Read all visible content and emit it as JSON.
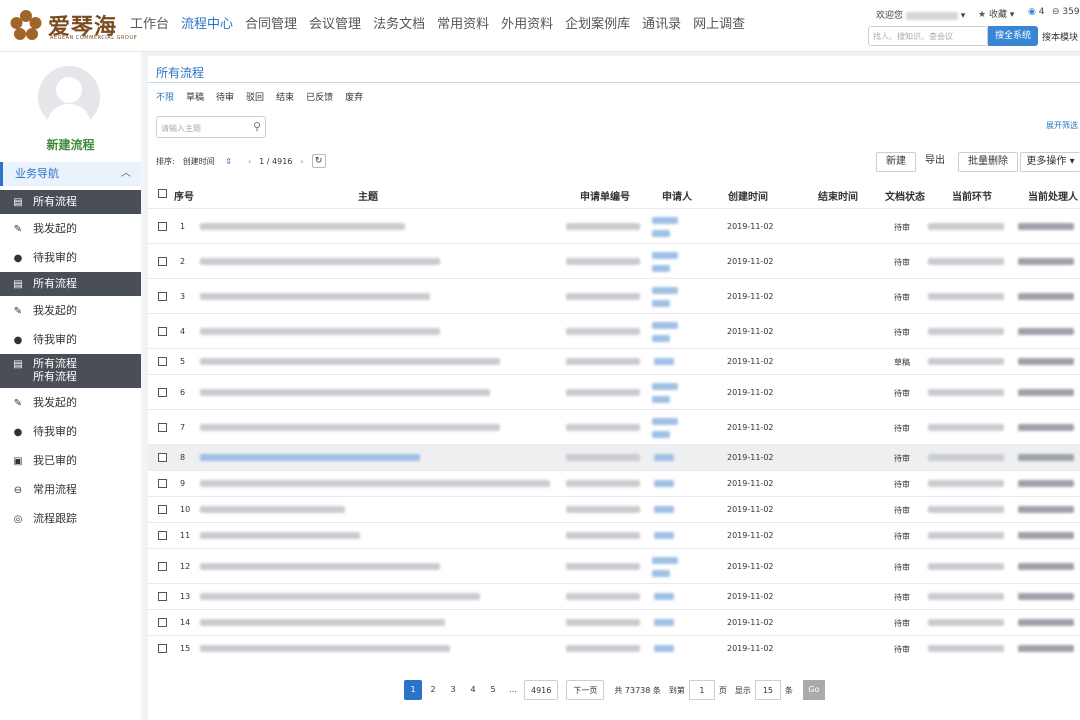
{
  "header": {
    "logo_text": "爱琴海",
    "logo_sub": "AEGEAN COMMERCIAL GROUP",
    "nav": [
      {
        "label": "工作台",
        "active": false
      },
      {
        "label": "流程中心",
        "active": true
      },
      {
        "label": "合同管理",
        "active": false
      },
      {
        "label": "会议管理",
        "active": false
      },
      {
        "label": "法务文档",
        "active": false
      },
      {
        "label": "常用资料",
        "active": false
      },
      {
        "label": "外用资料",
        "active": false
      },
      {
        "label": "企划案例库",
        "active": false
      },
      {
        "label": "通讯录",
        "active": false
      },
      {
        "label": "网上调查",
        "active": false
      }
    ],
    "welcome": "欢迎您",
    "favorites": "收藏",
    "badge_count_a": "4",
    "badge_count_b": "359",
    "search_placeholder": "找人、搜知识、查会议",
    "search_button": "搜全系统",
    "search_module": "搜本模块"
  },
  "sidebar": {
    "new_flow": "新建流程",
    "biz_nav": "业务导航",
    "items": [
      {
        "label": "所有流程",
        "icon": "doc-icon",
        "style": "dark"
      },
      {
        "label": "我发起的",
        "icon": "edit-icon",
        "style": ""
      },
      {
        "label": "待我审的",
        "icon": "user-icon",
        "style": ""
      },
      {
        "label": "所有流程",
        "icon": "doc-icon",
        "style": "dark"
      },
      {
        "label": "我发起的",
        "icon": "edit-icon",
        "style": ""
      },
      {
        "label": "待我审的",
        "icon": "user-icon",
        "style": ""
      },
      {
        "label": "所有流程",
        "label2": "所有流程",
        "icon": "doc-icon",
        "style": "dark2"
      },
      {
        "label": "我发起的",
        "icon": "edit-icon",
        "style": ""
      },
      {
        "label": "待我审的",
        "icon": "user-icon",
        "style": ""
      },
      {
        "label": "我已审的",
        "icon": "archive-icon",
        "style": ""
      },
      {
        "label": "常用流程",
        "icon": "minus-circle-icon",
        "style": ""
      },
      {
        "label": "流程跟踪",
        "icon": "target-icon",
        "style": ""
      }
    ]
  },
  "main": {
    "title": "所有流程",
    "tabs": [
      {
        "label": "不限",
        "active": true
      },
      {
        "label": "草稿",
        "active": false
      },
      {
        "label": "待审",
        "active": false
      },
      {
        "label": "驳回",
        "active": false
      },
      {
        "label": "结束",
        "active": false
      },
      {
        "label": "已反馈",
        "active": false
      },
      {
        "label": "废弃",
        "active": false
      }
    ],
    "search_placeholder": "请输入主题",
    "expand_filter": "展开筛选",
    "sort_label": "排序:",
    "sort_value": "创建时间",
    "page_indicator": "1 / 4916",
    "buttons": {
      "new": "新建",
      "export": "导出",
      "batch_delete": "批量删除",
      "more": "更多操作"
    },
    "columns": [
      "序号",
      "主题",
      "申请单编号",
      "申请人",
      "创建时间",
      "结束时间",
      "文档状态",
      "当前环节",
      "当前处理人"
    ],
    "rows": [
      {
        "no": "1",
        "date": "2019-11-02",
        "status": "待审"
      },
      {
        "no": "2",
        "date": "2019-11-02",
        "status": "待审"
      },
      {
        "no": "3",
        "date": "2019-11-02",
        "status": "待审"
      },
      {
        "no": "4",
        "date": "2019-11-02",
        "status": "待审"
      },
      {
        "no": "5",
        "date": "2019-11-02",
        "status": "草稿"
      },
      {
        "no": "6",
        "date": "2019-11-02",
        "status": "待审"
      },
      {
        "no": "7",
        "date": "2019-11-02",
        "status": "待审"
      },
      {
        "no": "8",
        "date": "2019-11-02",
        "status": "待审"
      },
      {
        "no": "9",
        "date": "2019-11-02",
        "status": "待审"
      },
      {
        "no": "10",
        "date": "2019-11-02",
        "status": "待审"
      },
      {
        "no": "11",
        "date": "2019-11-02",
        "status": "待审"
      },
      {
        "no": "12",
        "date": "2019-11-02",
        "status": "待审"
      },
      {
        "no": "13",
        "date": "2019-11-02",
        "status": "待审"
      },
      {
        "no": "14",
        "date": "2019-11-02",
        "status": "待审"
      },
      {
        "no": "15",
        "date": "2019-11-02",
        "status": "待审"
      }
    ],
    "pager": {
      "pages": [
        "1",
        "2",
        "3",
        "4",
        "5"
      ],
      "ellipsis": "...",
      "last": "4916",
      "next": "下一页",
      "total": "共 73738 条",
      "goto": "到第",
      "goto_value": "1",
      "page_unit": "页",
      "show": "显示",
      "show_value": "15",
      "item_unit": "条",
      "go": "Go"
    }
  }
}
